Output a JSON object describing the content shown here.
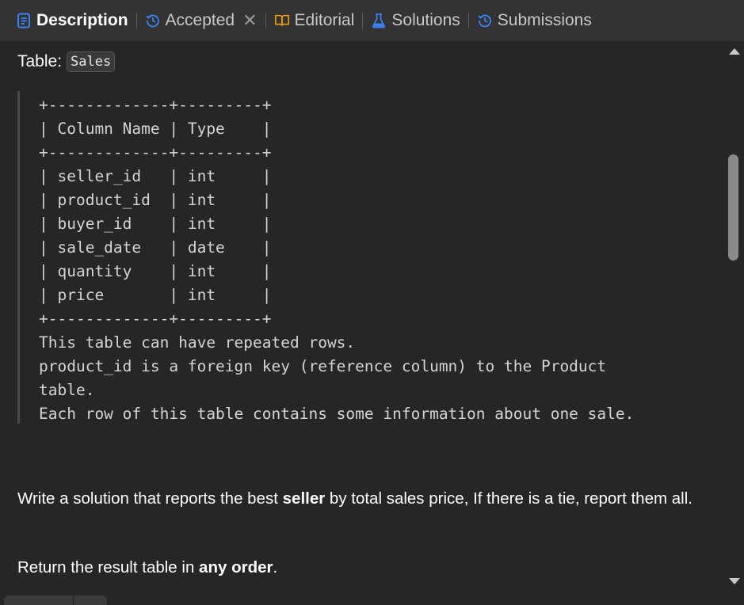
{
  "tabs": [
    {
      "label": "Description",
      "icon": "document-icon",
      "active": true
    },
    {
      "label": "Accepted",
      "icon": "history-icon",
      "closable": true,
      "close_glyph": "✕"
    },
    {
      "label": "Editorial",
      "icon": "book-icon"
    },
    {
      "label": "Solutions",
      "icon": "flask-icon"
    },
    {
      "label": "Submissions",
      "icon": "history-icon"
    }
  ],
  "colors": {
    "accent": "#3b82f6",
    "tabbar": "#333333",
    "background": "#262626"
  },
  "content": {
    "table_label": "Table:",
    "table_name": "Sales",
    "schema_block": "+-------------+---------+\n| Column Name | Type    |\n+-------------+---------+\n| seller_id   | int     |\n| product_id  | int     |\n| buyer_id    | int     |\n| sale_date   | date    |\n| quantity    | int     |\n| price       | int     |\n+-------------+---------+\nThis table can have repeated rows.\nproduct_id is a foreign key (reference column) to the Product\ntable.\nEach row of this table contains some information about one sale.",
    "paragraph1": {
      "before": "Write a solution that reports the best ",
      "bold": "seller",
      "after": " by total sales price, If there is a tie, report them all."
    },
    "paragraph2": {
      "before": "Return the result table in ",
      "bold": "any order",
      "after": "."
    }
  }
}
